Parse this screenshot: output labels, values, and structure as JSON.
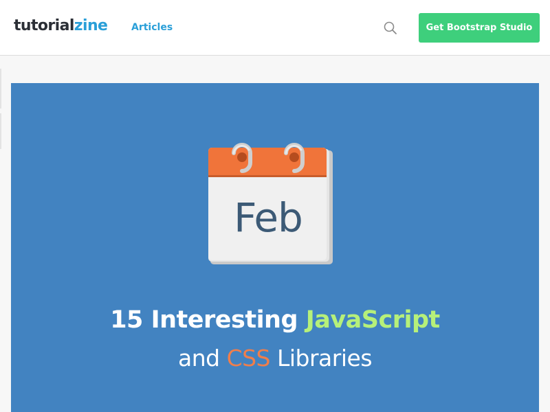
{
  "header": {
    "logo_part1": "tutorial",
    "logo_part2": "zine",
    "nav_articles": "Articles",
    "search_icon": "search-icon",
    "cta_label": "Get Bootstrap Studio"
  },
  "hero": {
    "calendar_month": "Feb",
    "title_prefix": "15 Interesting ",
    "title_highlight": "JavaScript",
    "subtitle_prefix": "and ",
    "subtitle_highlight": "CSS",
    "subtitle_suffix": " Libraries"
  },
  "colors": {
    "brand_dark": "#2b2f36",
    "brand_blue": "#2a9fd8",
    "cta_green": "#3ecf7c",
    "hero_bg": "#4283c1",
    "js_highlight": "#b6f07a",
    "css_highlight": "#f07e4b",
    "calendar_top": "#f0743a",
    "calendar_body": "#f0f0f0",
    "calendar_text": "#3c5a76"
  }
}
